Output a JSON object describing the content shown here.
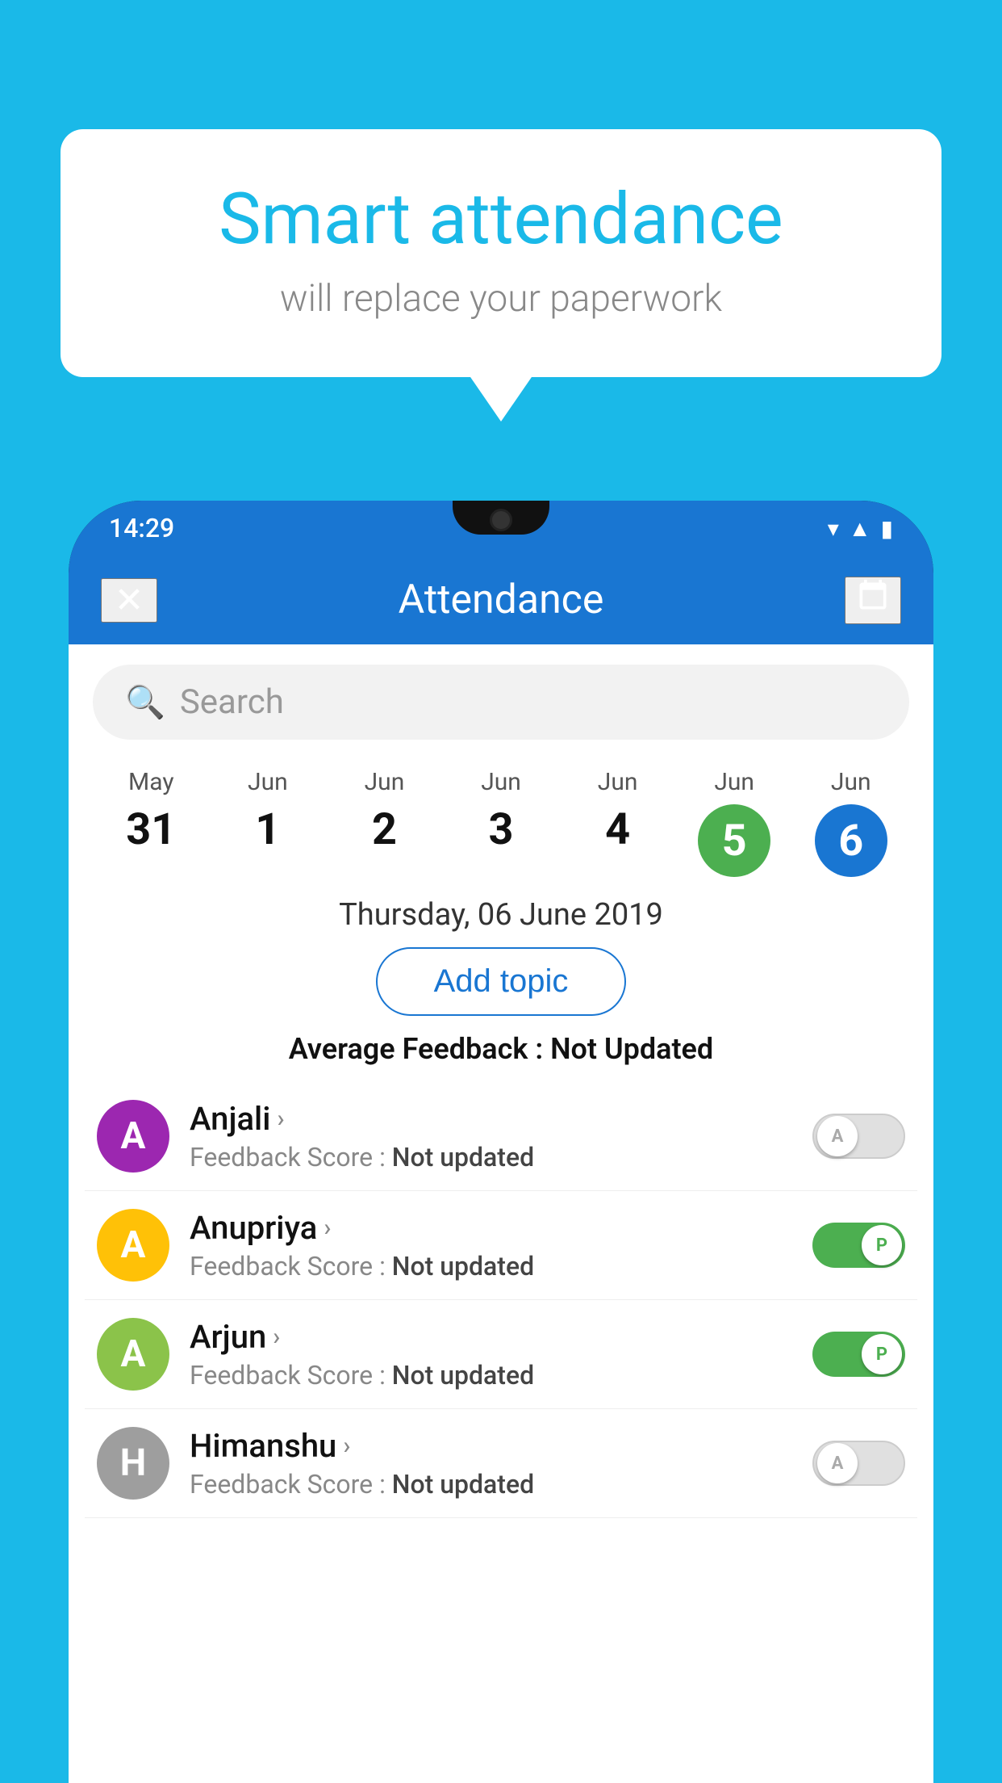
{
  "background_color": "#1ab9e8",
  "bubble": {
    "title": "Smart attendance",
    "subtitle": "will replace your paperwork"
  },
  "status_bar": {
    "time": "14:29",
    "icons": [
      "wifi",
      "signal",
      "battery"
    ]
  },
  "app_bar": {
    "title": "Attendance",
    "close_label": "×",
    "calendar_label": "📅"
  },
  "search": {
    "placeholder": "Search"
  },
  "dates": [
    {
      "month": "May",
      "day": "31",
      "type": "normal"
    },
    {
      "month": "Jun",
      "day": "1",
      "type": "normal"
    },
    {
      "month": "Jun",
      "day": "2",
      "type": "normal"
    },
    {
      "month": "Jun",
      "day": "3",
      "type": "normal"
    },
    {
      "month": "Jun",
      "day": "4",
      "type": "normal"
    },
    {
      "month": "Jun",
      "day": "5",
      "type": "today-green"
    },
    {
      "month": "Jun",
      "day": "6",
      "type": "today-blue"
    }
  ],
  "selected_date": "Thursday, 06 June 2019",
  "add_topic_label": "Add topic",
  "avg_feedback_label": "Average Feedback :",
  "avg_feedback_value": "Not Updated",
  "students": [
    {
      "name": "Anjali",
      "avatar_letter": "A",
      "avatar_color": "#9c27b0",
      "feedback_label": "Feedback Score :",
      "feedback_value": "Not updated",
      "toggle_state": "off",
      "toggle_letter": "A"
    },
    {
      "name": "Anupriya",
      "avatar_letter": "A",
      "avatar_color": "#ffc107",
      "feedback_label": "Feedback Score :",
      "feedback_value": "Not updated",
      "toggle_state": "on",
      "toggle_letter": "P"
    },
    {
      "name": "Arjun",
      "avatar_letter": "A",
      "avatar_color": "#8bc34a",
      "feedback_label": "Feedback Score :",
      "feedback_value": "Not updated",
      "toggle_state": "on",
      "toggle_letter": "P"
    },
    {
      "name": "Himanshu",
      "avatar_letter": "H",
      "avatar_color": "#9e9e9e",
      "feedback_label": "Feedback Score :",
      "feedback_value": "Not updated",
      "toggle_state": "off",
      "toggle_letter": "A"
    }
  ]
}
